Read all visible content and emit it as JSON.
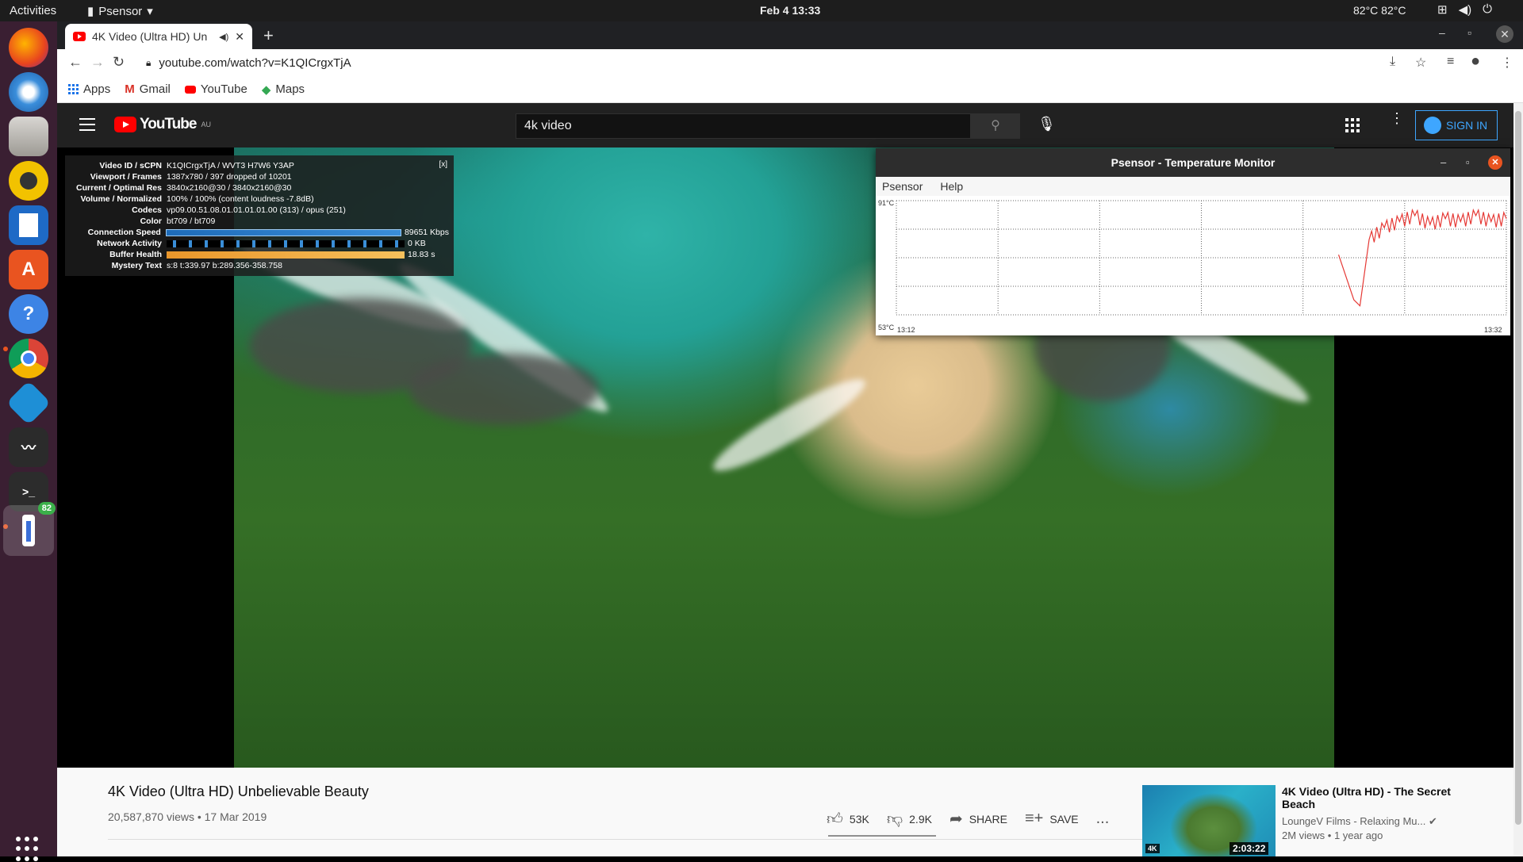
{
  "topbar": {
    "activities": "Activities",
    "app_name": "Psensor",
    "clock": "Feb 4  13:33",
    "sensor": "82°C 82°C"
  },
  "dock": {
    "apps": [
      "firefox-icon",
      "thunderbird-icon",
      "files-icon",
      "rhythmbox-icon",
      "writer-icon",
      "software-icon",
      "help-icon",
      "chrome-icon",
      "kodi-icon",
      "system-monitor-icon",
      "terminal-icon",
      "psensor-icon"
    ],
    "psensor_badge": "82"
  },
  "browser": {
    "tab_title": "4K Video (Ultra HD) Un",
    "url": "youtube.com/watch?v=K1QICrgxTjA",
    "bookmarks": [
      "Apps",
      "Gmail",
      "YouTube",
      "Maps"
    ]
  },
  "youtube": {
    "logo": "YouTube",
    "region": "AU",
    "search_value": "4k video",
    "sign_in": "SIGN IN"
  },
  "stats": {
    "close": "[x]",
    "rows": [
      {
        "k": "Video ID / sCPN",
        "v": "K1QICrgxTjA / WVT3 H7W6 Y3AP"
      },
      {
        "k": "Viewport / Frames",
        "v": "1387x780 / 397 dropped of 10201"
      },
      {
        "k": "Current / Optimal Res",
        "v": "3840x2160@30 / 3840x2160@30"
      },
      {
        "k": "Volume / Normalized",
        "v": "100% / 100% (content loudness -7.8dB)"
      },
      {
        "k": "Codecs",
        "v": "vp09.00.51.08.01.01.01.01.00 (313) / opus (251)"
      },
      {
        "k": "Color",
        "v": "bt709 / bt709"
      },
      {
        "k": "Connection Speed",
        "v": "89651 Kbps"
      },
      {
        "k": "Network Activity",
        "v": "0 KB"
      },
      {
        "k": "Buffer Health",
        "v": "18.83 s"
      },
      {
        "k": "Mystery Text",
        "v": "s:8 t:339.97 b:289.356-358.758"
      }
    ]
  },
  "psensor": {
    "title": "Psensor - Temperature Monitor",
    "menu": [
      "Psensor",
      "Help"
    ],
    "y_max": "91°C",
    "y_min": "53°C",
    "x_start": "13:12",
    "x_end": "13:32"
  },
  "chart_data": {
    "type": "line",
    "title": "",
    "xlabel": "",
    "ylabel": "",
    "x_range": [
      "13:12",
      "13:32"
    ],
    "ylim": [
      53,
      91
    ],
    "grid": true,
    "series": [
      {
        "color": "#e53935",
        "x": [
          "13:26.5",
          "13:27",
          "13:27.2",
          "13:27.5",
          "13:28",
          "13:28.5",
          "13:29",
          "13:29.5",
          "13:30",
          "13:30.5",
          "13:31",
          "13:31.5",
          "13:32"
        ],
        "values": [
          73,
          58,
          56,
          78,
          82,
          84,
          86,
          83,
          85,
          84,
          86,
          84,
          85
        ]
      }
    ]
  },
  "video": {
    "title": "4K Video (Ultra HD) Unbelievable Beauty",
    "meta": "20,587,870 views • 17 Mar 2019",
    "likes": "53K",
    "dislikes": "2.9K",
    "share": "SHARE",
    "save": "SAVE",
    "more": "..."
  },
  "recommendation": {
    "title": "4K Video (Ultra HD) - The Secret Beach",
    "channel": "LoungeV Films - Relaxing Mu...",
    "meta": "2M views • 1 year ago",
    "duration": "2:03:22",
    "badge": "4K"
  }
}
